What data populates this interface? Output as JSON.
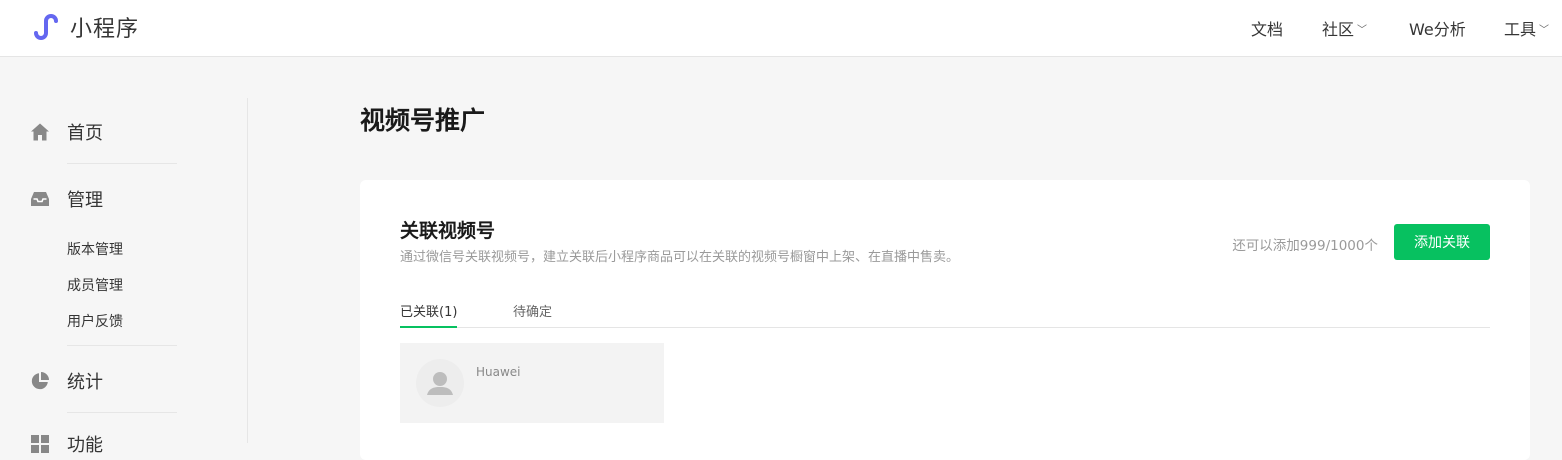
{
  "header": {
    "brand": "小程序",
    "nav": [
      {
        "label": "文档",
        "has_dropdown": false
      },
      {
        "label": "社区",
        "has_dropdown": true
      },
      {
        "label": "We分析",
        "has_dropdown": false
      },
      {
        "label": "工具",
        "has_dropdown": true
      }
    ],
    "dropdown_glyph": "﹀"
  },
  "sidebar": {
    "sections": [
      {
        "label": "首页",
        "icon": "home-icon"
      },
      {
        "label": "管理",
        "icon": "inbox-icon",
        "items": [
          "版本管理",
          "成员管理",
          "用户反馈"
        ]
      },
      {
        "label": "统计",
        "icon": "pie-chart-icon"
      },
      {
        "label": "功能",
        "icon": "grid-icon"
      }
    ]
  },
  "main": {
    "title": "视频号推广",
    "card": {
      "title": "关联视频号",
      "description": "通过微信号关联视频号，建立关联后小程序商品可以在关联的视频号橱窗中上架、在直播中售卖。",
      "quota": "还可以添加999/1000个",
      "add_button": "添加关联",
      "tabs": [
        {
          "label": "已关联(1)",
          "active": true
        },
        {
          "label": "待确定",
          "active": false
        }
      ],
      "items": [
        {
          "name": "Huawei",
          "icon": "user-avatar-icon"
        }
      ]
    }
  },
  "colors": {
    "accent": "#07c160",
    "brand": "#6467f0",
    "icon_gray": "#888888"
  }
}
